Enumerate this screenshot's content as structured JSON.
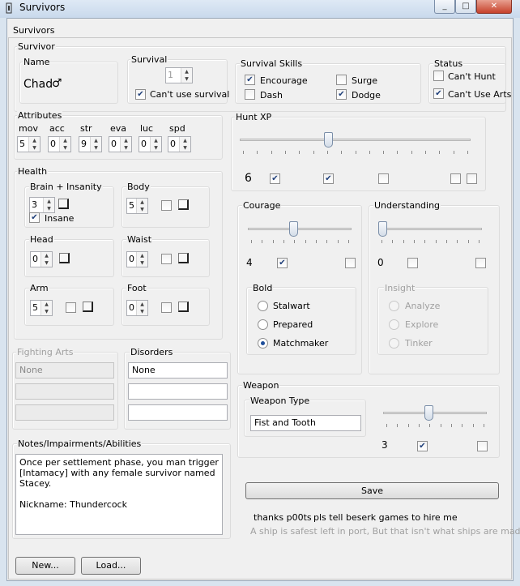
{
  "window": {
    "title": "Survivors",
    "minimize": "_",
    "maximize": "□",
    "close": "✕"
  },
  "tab": {
    "label": "Survivors"
  },
  "survivor": {
    "group": "Survivor",
    "name_group": "Name",
    "name": "Chad",
    "gender_symbol": "♂",
    "survival_group": "Survival",
    "survival_value": "1",
    "cant_use_survival_label": "Can't use survival",
    "cant_use_survival": true,
    "skills_group": "Survival Skills",
    "skills": {
      "encourage": "Encourage",
      "dash": "Dash",
      "surge": "Surge",
      "dodge": "Dodge"
    },
    "status_group": "Status",
    "cant_hunt": "Can't Hunt",
    "cant_use_arts": "Can't Use Arts",
    "attributes_group": "Attributes",
    "attributes": [
      {
        "label": "mov",
        "value": "5"
      },
      {
        "label": "acc",
        "value": "0"
      },
      {
        "label": "str",
        "value": "9"
      },
      {
        "label": "eva",
        "value": "0"
      },
      {
        "label": "luc",
        "value": "0"
      },
      {
        "label": "spd",
        "value": "0"
      }
    ],
    "hunt_xp_group": "Hunt XP",
    "hunt_xp_value": "6",
    "hunt_xp_level": 0.38
  },
  "health": {
    "group": "Health",
    "brain_group": "Brain + Insanity",
    "brain_value": "3",
    "insane_label": "Insane",
    "body_group": "Body",
    "body_value": "5",
    "head_group": "Head",
    "head_value": "0",
    "waist_group": "Waist",
    "waist_value": "0",
    "arm_group": "Arm",
    "arm_value": "5",
    "foot_group": "Foot",
    "foot_value": "0"
  },
  "courage": {
    "group": "Courage",
    "value": "4",
    "level": 0.44,
    "bold_group": "Bold",
    "options": [
      "Stalwart",
      "Prepared",
      "Matchmaker"
    ],
    "selected": "Matchmaker"
  },
  "understanding": {
    "group": "Understanding",
    "value": "0",
    "level": 0,
    "insight_group": "Insight",
    "options": [
      "Analyze",
      "Explore",
      "Tinker"
    ]
  },
  "fighting_arts": {
    "group": "Fighting Arts",
    "items": [
      "None",
      "",
      ""
    ]
  },
  "disorders": {
    "group": "Disorders",
    "items": [
      "None",
      "",
      ""
    ]
  },
  "weapon": {
    "group": "Weapon",
    "type_group": "Weapon Type",
    "type": "Fist and Tooth",
    "value": "3",
    "level": 0.44
  },
  "notes": {
    "group": "Notes/Impairments/Abilities",
    "text": "Once per settlement phase, you man trigger\n[Intamacy] with any female survivor named Stacey.\n\nNickname: Thundercock"
  },
  "actions": {
    "save": "Save",
    "new": "New...",
    "load": "Load..."
  },
  "footer": {
    "thanks": "thanks p00ts",
    "hire": "pls tell beserk games to hire me",
    "quote": "A ship is safest left in port, But that isn't what ships are made for"
  }
}
